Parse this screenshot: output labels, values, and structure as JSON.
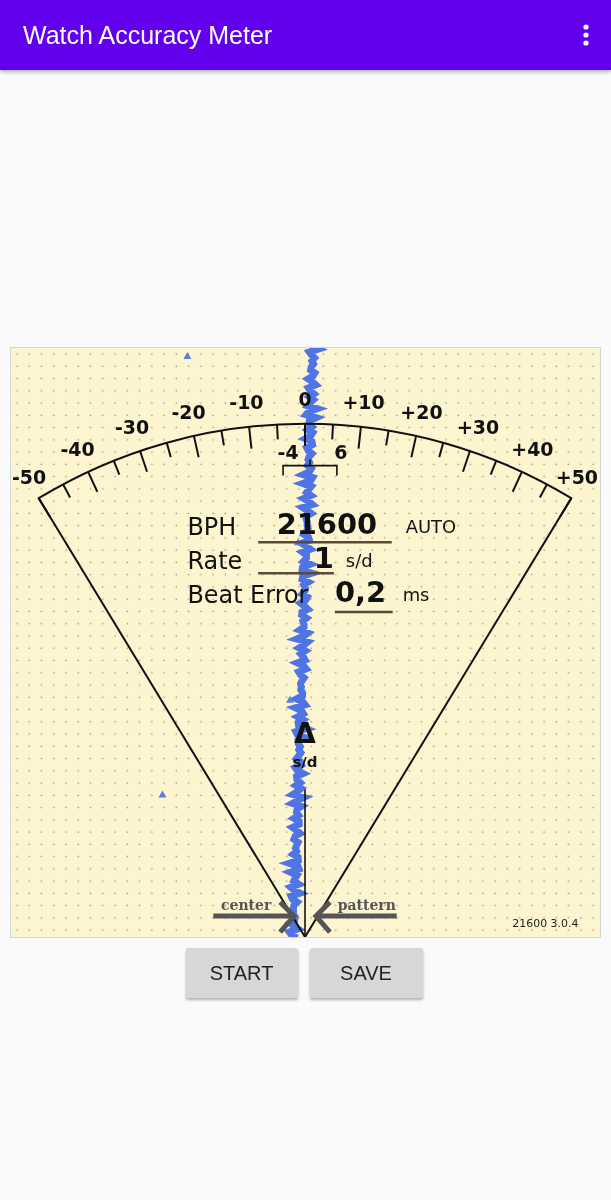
{
  "app_bar": {
    "title": "Watch Accuracy Meter"
  },
  "gauge": {
    "scale_labels": [
      "-50",
      "-40",
      "-30",
      "-20",
      "-10",
      "0",
      "+10",
      "+20",
      "+30",
      "+40",
      "+50"
    ],
    "inner_labels": [
      "-4",
      "6"
    ],
    "readouts": [
      {
        "label": "BPH",
        "value": "21600",
        "unit": "AUTO"
      },
      {
        "label": "Rate",
        "value": "1",
        "unit": "s/d"
      },
      {
        "label": "Beat Error",
        "value": "0,2",
        "unit": "ms"
      }
    ],
    "delta_symbol": "Δ",
    "delta_unit": "s/d",
    "center_label": "center",
    "pattern_label": "pattern",
    "version": "21600 3.0.4"
  },
  "buttons": [
    {
      "label": "START"
    },
    {
      "label": "SAVE"
    }
  ]
}
